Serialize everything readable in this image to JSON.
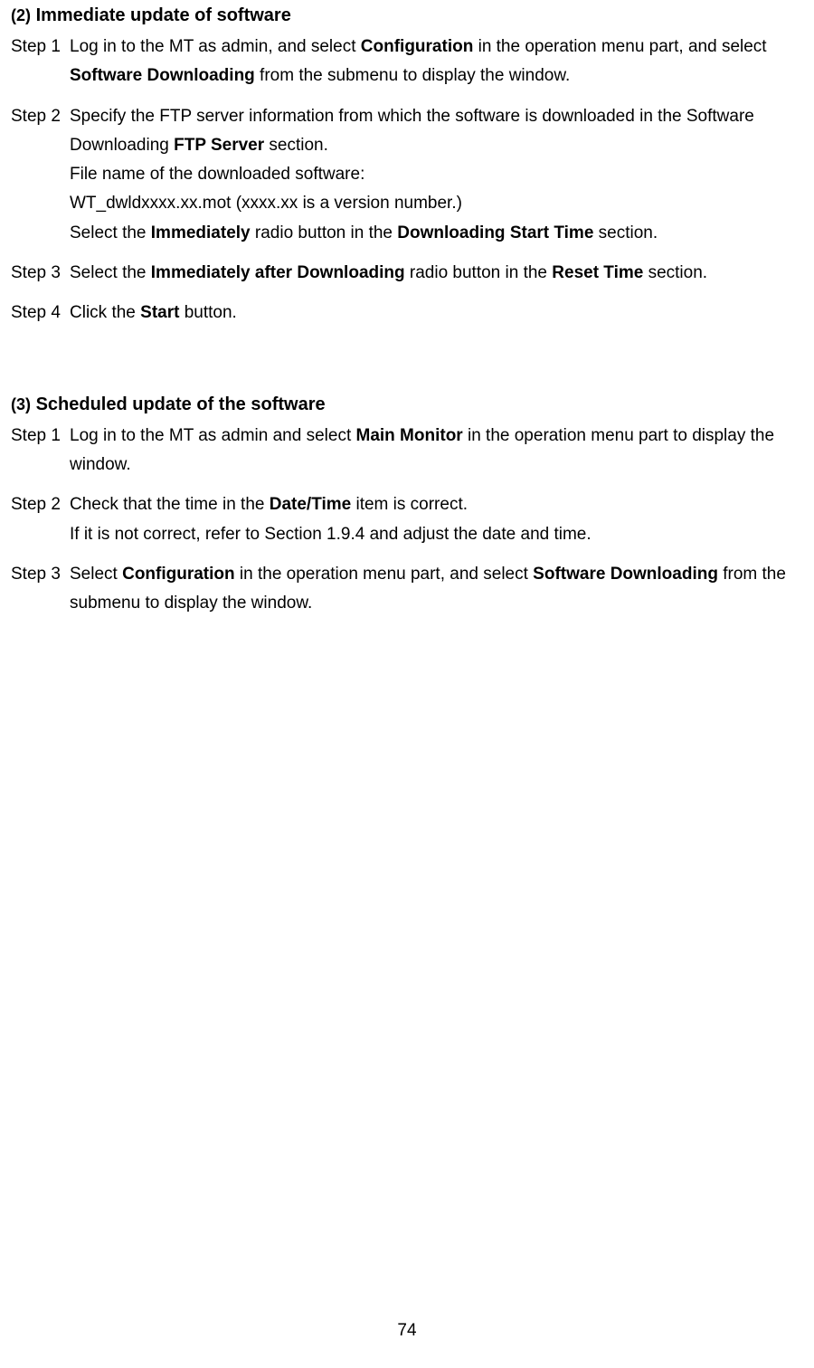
{
  "section2": {
    "num": "(2)",
    "title": "Immediate update of software",
    "step1": {
      "label": "Step 1",
      "t1a": "Log in to the MT as admin, and select ",
      "t1b": "Configuration",
      "t1c": " in the operation menu part, and select ",
      "t1d": "Software Downloading",
      "t1e": " from the submenu to display the window."
    },
    "step2": {
      "label": "Step 2",
      "t1a": "Specify the FTP server information from which the software is downloaded in the Software Downloading ",
      "t1b": "FTP Server",
      "t1c": " section.",
      "t2": "File name of the downloaded software:",
      "t3": "WT_dwldxxxx.xx.mot (xxxx.xx is a version number.)",
      "t4a": "Select the ",
      "t4b": "Immediately",
      "t4c": " radio button in the ",
      "t4d": "Downloading Start Time",
      "t4e": " section."
    },
    "step3": {
      "label": "Step 3",
      "t1a": "Select the ",
      "t1b": "Immediately after Downloading",
      "t1c": " radio button in the ",
      "t1d": "Reset Time",
      "t1e": " section."
    },
    "step4": {
      "label": "Step 4",
      "t1a": "Click the ",
      "t1b": "Start",
      "t1c": " button."
    }
  },
  "section3": {
    "num": "(3)",
    "title": "Scheduled update of the software",
    "step1": {
      "label": "Step 1",
      "t1a": "Log in to the MT as admin and select ",
      "t1b": "Main Monitor",
      "t1c": " in the operation menu part to display the window."
    },
    "step2": {
      "label": "Step 2",
      "t1a": "Check that the time in the ",
      "t1b": "Date/Time",
      "t1c": " item is correct.",
      "t2": "If it is not correct, refer to Section 1.9.4 and adjust the date and time."
    },
    "step3": {
      "label": "Step 3",
      "t1a": "Select ",
      "t1b": "Configuration",
      "t1c": " in the operation menu part, and select ",
      "t1d": "Software Downloading",
      "t1e": " from the submenu to display the window."
    }
  },
  "pageNumber": "74"
}
